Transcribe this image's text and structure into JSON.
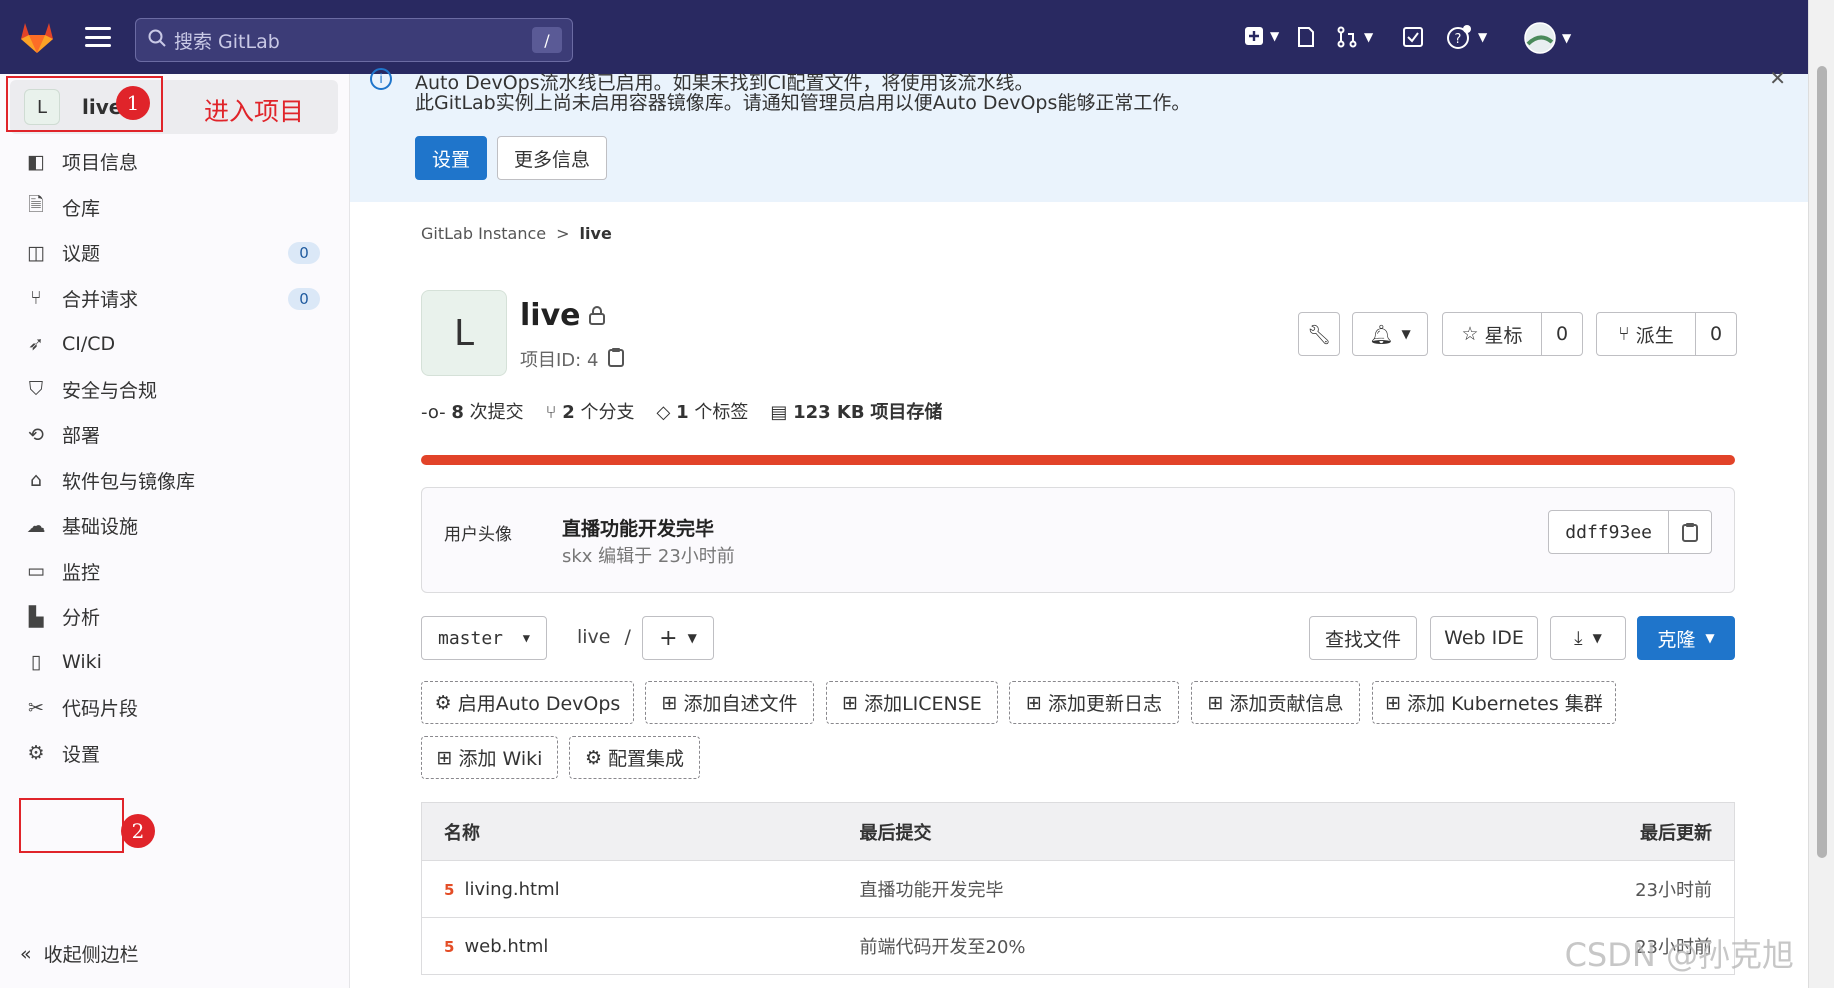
{
  "topbar": {
    "search_placeholder": "搜索 GitLab",
    "search_shortcut": "/"
  },
  "sidebar": {
    "project_initial": "L",
    "project_name": "live",
    "items": [
      {
        "label": "项目信息",
        "icon": "info-icon"
      },
      {
        "label": "仓库",
        "icon": "document-icon"
      },
      {
        "label": "议题",
        "icon": "issues-icon",
        "count": "0"
      },
      {
        "label": "合并请求",
        "icon": "merge-request-icon",
        "count": "0"
      },
      {
        "label": "CI/CD",
        "icon": "rocket-icon"
      },
      {
        "label": "安全与合规",
        "icon": "shield-icon"
      },
      {
        "label": "部署",
        "icon": "deploy-icon"
      },
      {
        "label": "软件包与镜像库",
        "icon": "package-icon"
      },
      {
        "label": "基础设施",
        "icon": "cloud-icon"
      },
      {
        "label": "监控",
        "icon": "monitor-icon"
      },
      {
        "label": "分析",
        "icon": "chart-icon"
      },
      {
        "label": "Wiki",
        "icon": "book-icon"
      },
      {
        "label": "代码片段",
        "icon": "snippet-icon"
      },
      {
        "label": "设置",
        "icon": "gear-icon"
      }
    ],
    "collapse_label": "收起侧边栏"
  },
  "annotations": {
    "badge1": "1",
    "badge2": "2",
    "enter_project": "进入项目"
  },
  "banner": {
    "line1": "Auto DevOps流水线已启用。如果未找到CI配置文件，将使用该流水线。",
    "line2": "此GitLab实例上尚未启用容器镜像库。请通知管理员启用以便Auto DevOps能够正常工作。",
    "settings_button": "设置",
    "more_info_button": "更多信息"
  },
  "breadcrumb": {
    "root": "GitLab Instance",
    "separator": ">",
    "current": "live"
  },
  "project": {
    "initial": "L",
    "title": "live",
    "id_label": "项目ID: 4",
    "star_label": "星标",
    "star_count": "0",
    "fork_label": "派生",
    "fork_count": "0"
  },
  "stats": {
    "commits_num": "8",
    "commits_label": "次提交",
    "branches_num": "2",
    "branches_label": "个分支",
    "tags_num": "1",
    "tags_label": "个标签",
    "storage_num": "123 KB",
    "storage_label": "项目存储"
  },
  "commit": {
    "avatar_alt": "用户头像",
    "message": "直播功能开发完毕",
    "meta": "skx 编辑于 23小时前",
    "sha": "ddff93ee"
  },
  "toolbar": {
    "branch": "master",
    "path_root": "live",
    "path_sep": "/",
    "find_file": "查找文件",
    "web_ide": "Web IDE",
    "clone": "克隆"
  },
  "quick_actions": [
    "启用Auto DevOps",
    "添加自述文件",
    "添加LICENSE",
    "添加更新日志",
    "添加贡献信息",
    "添加 Kubernetes 集群",
    "添加 Wiki",
    "配置集成"
  ],
  "files": {
    "headers": [
      "名称",
      "最后提交",
      "最后更新"
    ],
    "rows": [
      {
        "name": "living.html",
        "commit": "直播功能开发完毕",
        "updated": "23小时前"
      },
      {
        "name": "web.html",
        "commit": "前端代码开发至20%",
        "updated": "23小时前"
      }
    ]
  },
  "watermark": "CSDN @孙克旭",
  "colors": {
    "nav_bg": "#292961",
    "primary": "#1f75cb",
    "progress": "#e24329",
    "annotation_red": "#e0242a"
  }
}
